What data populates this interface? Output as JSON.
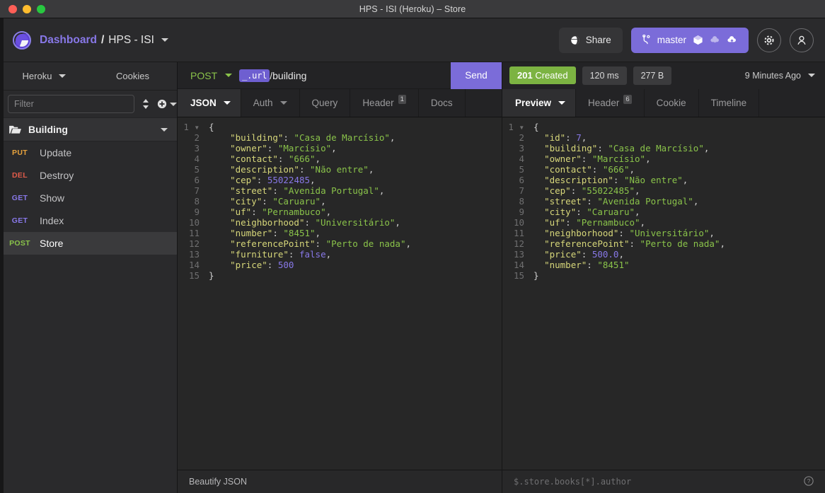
{
  "window": {
    "title": "HPS - ISI (Heroku) – Store",
    "traffic_lights": [
      "close",
      "minimize",
      "zoom"
    ]
  },
  "header": {
    "logo": "app-logo",
    "breadcrumb": {
      "root": "Dashboard",
      "separator": "/",
      "current": "HPS - ISI"
    },
    "share_label": "Share",
    "branch_label": "master",
    "branch_icons": [
      "git-branch-icon",
      "package-icon",
      "cloud-download-icon",
      "cloud-upload-icon"
    ],
    "settings_icon": "gear-icon",
    "account_icon": "user-icon"
  },
  "sidebar": {
    "tabs": [
      {
        "label": "Heroku",
        "has_caret": true,
        "active": true
      },
      {
        "label": "Cookies",
        "has_caret": false,
        "active": false
      }
    ],
    "filter": {
      "placeholder": "Filter",
      "value": ""
    },
    "sort_icon": "sort-icon",
    "add_icon": "add-circle-icon",
    "folder": {
      "name": "Building",
      "icon": "folder-open-icon",
      "expanded": true
    },
    "requests": [
      {
        "method": "PUT",
        "name": "Update",
        "active": false
      },
      {
        "method": "DEL",
        "name": "Destroy",
        "active": false
      },
      {
        "method": "GET",
        "name": "Show",
        "active": false
      },
      {
        "method": "GET",
        "name": "Index",
        "active": false
      },
      {
        "method": "POST",
        "name": "Store",
        "active": true
      }
    ]
  },
  "request": {
    "method": "POST",
    "url_chip": "_.url",
    "url_path": "/building",
    "send_label": "Send",
    "tabs": [
      {
        "label": "JSON",
        "caret": true,
        "badge": "",
        "active": true
      },
      {
        "label": "Auth",
        "caret": true,
        "badge": "",
        "active": false
      },
      {
        "label": "Query",
        "caret": false,
        "badge": "",
        "active": false
      },
      {
        "label": "Header",
        "caret": false,
        "badge": "1",
        "active": false
      },
      {
        "label": "Docs",
        "caret": false,
        "badge": "",
        "active": false
      }
    ],
    "body_lines": [
      {
        "n": 1,
        "fold": true,
        "html": "<span class=\"p\">{</span>"
      },
      {
        "n": 2,
        "fold": false,
        "html": "    <span class=\"k\">\"building\"</span><span class=\"p\">: </span><span class=\"s\">\"Casa de Marcísio\"</span><span class=\"p\">,</span>"
      },
      {
        "n": 3,
        "fold": false,
        "html": "    <span class=\"k\">\"owner\"</span><span class=\"p\">: </span><span class=\"s\">\"Marcísio\"</span><span class=\"p\">,</span>"
      },
      {
        "n": 4,
        "fold": false,
        "html": "    <span class=\"k\">\"contact\"</span><span class=\"p\">: </span><span class=\"s\">\"666\"</span><span class=\"p\">,</span>"
      },
      {
        "n": 5,
        "fold": false,
        "html": "    <span class=\"k\">\"description\"</span><span class=\"p\">: </span><span class=\"s\">\"Não entre\"</span><span class=\"p\">,</span>"
      },
      {
        "n": 6,
        "fold": false,
        "html": "    <span class=\"k\">\"cep\"</span><span class=\"p\">: </span><span class=\"n\">55022485</span><span class=\"p\">,</span>"
      },
      {
        "n": 7,
        "fold": false,
        "html": "    <span class=\"k\">\"street\"</span><span class=\"p\">: </span><span class=\"s\">\"Avenida Portugal\"</span><span class=\"p\">,</span>"
      },
      {
        "n": 8,
        "fold": false,
        "html": "    <span class=\"k\">\"city\"</span><span class=\"p\">: </span><span class=\"s\">\"Caruaru\"</span><span class=\"p\">,</span>"
      },
      {
        "n": 9,
        "fold": false,
        "html": "    <span class=\"k\">\"uf\"</span><span class=\"p\">: </span><span class=\"s\">\"Pernambuco\"</span><span class=\"p\">,</span>"
      },
      {
        "n": 10,
        "fold": false,
        "html": "    <span class=\"k\">\"neighborhood\"</span><span class=\"p\">: </span><span class=\"s\">\"Universitário\"</span><span class=\"p\">,</span>"
      },
      {
        "n": 11,
        "fold": false,
        "html": "    <span class=\"k\">\"number\"</span><span class=\"p\">: </span><span class=\"s\">\"8451\"</span><span class=\"p\">,</span>"
      },
      {
        "n": 12,
        "fold": false,
        "html": "    <span class=\"k\">\"referencePoint\"</span><span class=\"p\">: </span><span class=\"s\">\"Perto de nada\"</span><span class=\"p\">,</span>"
      },
      {
        "n": 13,
        "fold": false,
        "html": "    <span class=\"k\">\"furniture\"</span><span class=\"p\">: </span><span class=\"n\">false</span><span class=\"p\">,</span>"
      },
      {
        "n": 14,
        "fold": false,
        "html": "    <span class=\"k\">\"price\"</span><span class=\"p\">: </span><span class=\"n\">500</span>"
      },
      {
        "n": 15,
        "fold": false,
        "html": "<span class=\"p\">}</span>"
      }
    ],
    "footer_label": "Beautify JSON"
  },
  "response": {
    "status_code": "201",
    "status_text": "Created",
    "time": "120 ms",
    "size": "277 B",
    "ago": "9 Minutes Ago",
    "tabs": [
      {
        "label": "Preview",
        "caret": true,
        "badge": "",
        "active": true
      },
      {
        "label": "Header",
        "caret": false,
        "badge": "6",
        "active": false
      },
      {
        "label": "Cookie",
        "caret": false,
        "badge": "",
        "active": false
      },
      {
        "label": "Timeline",
        "caret": false,
        "badge": "",
        "active": false
      }
    ],
    "body_lines": [
      {
        "n": 1,
        "fold": true,
        "html": "<span class=\"p\">{</span>"
      },
      {
        "n": 2,
        "fold": false,
        "html": "  <span class=\"k\">\"id\"</span><span class=\"p\">: </span><span class=\"n\">7</span><span class=\"p\">,</span>"
      },
      {
        "n": 3,
        "fold": false,
        "html": "  <span class=\"k\">\"building\"</span><span class=\"p\">: </span><span class=\"s\">\"Casa de Marcísio\"</span><span class=\"p\">,</span>"
      },
      {
        "n": 4,
        "fold": false,
        "html": "  <span class=\"k\">\"owner\"</span><span class=\"p\">: </span><span class=\"s\">\"Marcísio\"</span><span class=\"p\">,</span>"
      },
      {
        "n": 5,
        "fold": false,
        "html": "  <span class=\"k\">\"contact\"</span><span class=\"p\">: </span><span class=\"s\">\"666\"</span><span class=\"p\">,</span>"
      },
      {
        "n": 6,
        "fold": false,
        "html": "  <span class=\"k\">\"description\"</span><span class=\"p\">: </span><span class=\"s\">\"Não entre\"</span><span class=\"p\">,</span>"
      },
      {
        "n": 7,
        "fold": false,
        "html": "  <span class=\"k\">\"cep\"</span><span class=\"p\">: </span><span class=\"s\">\"55022485\"</span><span class=\"p\">,</span>"
      },
      {
        "n": 8,
        "fold": false,
        "html": "  <span class=\"k\">\"street\"</span><span class=\"p\">: </span><span class=\"s\">\"Avenida Portugal\"</span><span class=\"p\">,</span>"
      },
      {
        "n": 9,
        "fold": false,
        "html": "  <span class=\"k\">\"city\"</span><span class=\"p\">: </span><span class=\"s\">\"Caruaru\"</span><span class=\"p\">,</span>"
      },
      {
        "n": 10,
        "fold": false,
        "html": "  <span class=\"k\">\"uf\"</span><span class=\"p\">: </span><span class=\"s\">\"Pernambuco\"</span><span class=\"p\">,</span>"
      },
      {
        "n": 11,
        "fold": false,
        "html": "  <span class=\"k\">\"neighborhood\"</span><span class=\"p\">: </span><span class=\"s\">\"Universitário\"</span><span class=\"p\">,</span>"
      },
      {
        "n": 12,
        "fold": false,
        "html": "  <span class=\"k\">\"referencePoint\"</span><span class=\"p\">: </span><span class=\"s\">\"Perto de nada\"</span><span class=\"p\">,</span>"
      },
      {
        "n": 13,
        "fold": false,
        "html": "  <span class=\"k\">\"price\"</span><span class=\"p\">: </span><span class=\"n\">500.0</span><span class=\"p\">,</span>"
      },
      {
        "n": 14,
        "fold": false,
        "html": "  <span class=\"k\">\"number\"</span><span class=\"p\">: </span><span class=\"s\">\"8451\"</span>"
      },
      {
        "n": 15,
        "fold": false,
        "html": "<span class=\"p\">}</span>"
      }
    ],
    "filter_placeholder": "$.store.books[*].author",
    "help_icon": "help-circle-icon"
  },
  "colors": {
    "accent_purple": "#7b6cd9",
    "status_green": "#7cb342",
    "method_post": "#8ac34a",
    "method_get": "#8878e8",
    "method_put": "#e8a33d",
    "method_del": "#e05b4a",
    "bg_chrome": "#2a2a2c",
    "bg_editor": "#272727"
  }
}
